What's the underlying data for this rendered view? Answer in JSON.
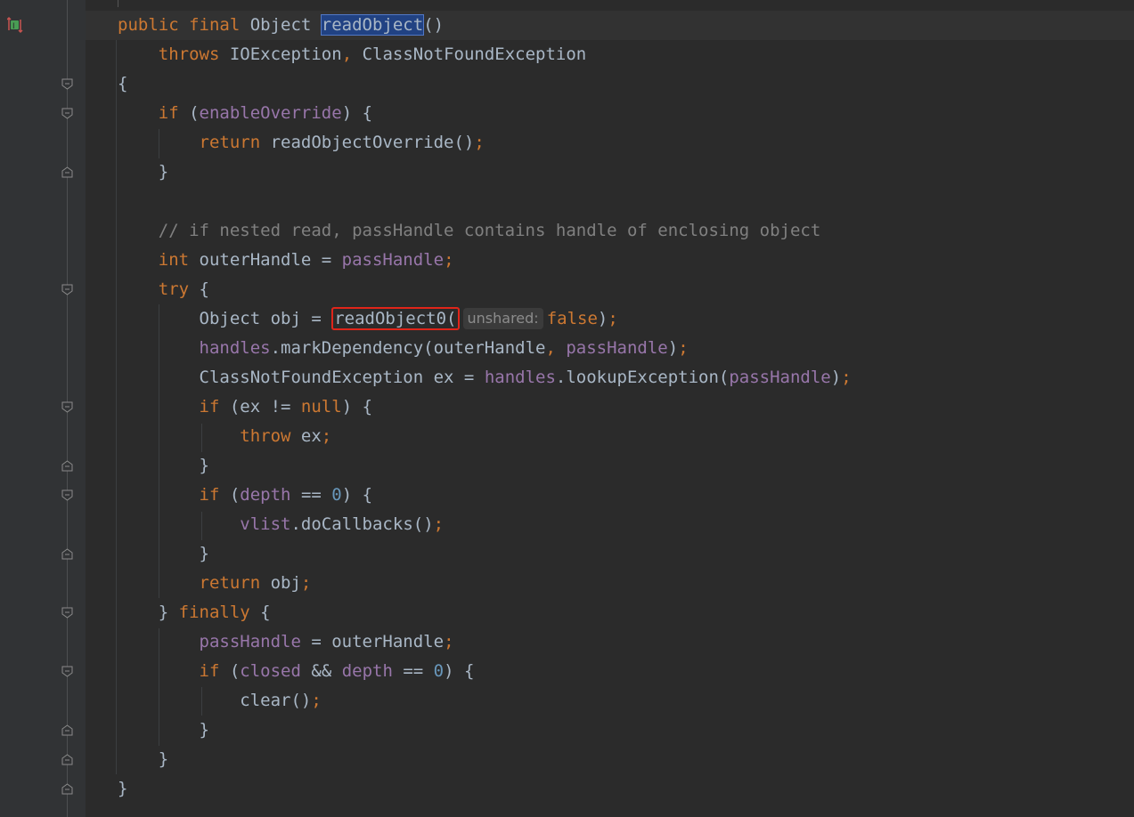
{
  "editor": {
    "lines": [
      {
        "tokens": [
          {
            "t": "public final ",
            "c": "kw"
          },
          {
            "t": "Object ",
            "c": "plain"
          },
          {
            "t": "readObject",
            "c": "sel"
          },
          {
            "t": "()",
            "c": "plain"
          }
        ]
      },
      {
        "tokens": [
          {
            "t": "    throws ",
            "c": "kw"
          },
          {
            "t": "IOException",
            "c": "plain"
          },
          {
            "t": ", ",
            "c": "kw"
          },
          {
            "t": "ClassNotFoundException",
            "c": "plain"
          }
        ]
      },
      {
        "tokens": [
          {
            "t": "{",
            "c": "plain"
          }
        ]
      },
      {
        "tokens": [
          {
            "t": "    if ",
            "c": "kw"
          },
          {
            "t": "(",
            "c": "plain"
          },
          {
            "t": "enableOverride",
            "c": "fld"
          },
          {
            "t": ") {",
            "c": "plain"
          }
        ]
      },
      {
        "tokens": [
          {
            "t": "        return ",
            "c": "kw"
          },
          {
            "t": "readObjectOverride()",
            "c": "plain"
          },
          {
            "t": ";",
            "c": "kw"
          }
        ]
      },
      {
        "tokens": [
          {
            "t": "    }",
            "c": "plain"
          }
        ]
      },
      {
        "tokens": []
      },
      {
        "tokens": [
          {
            "t": "    // if nested read, passHandle contains handle of enclosing object",
            "c": "cmt"
          }
        ]
      },
      {
        "tokens": [
          {
            "t": "    int ",
            "c": "kw"
          },
          {
            "t": "outerHandle = ",
            "c": "plain"
          },
          {
            "t": "passHandle",
            "c": "fld"
          },
          {
            "t": ";",
            "c": "kw"
          }
        ]
      },
      {
        "tokens": [
          {
            "t": "    try ",
            "c": "kw"
          },
          {
            "t": "{",
            "c": "plain"
          }
        ]
      },
      {
        "tokens": [
          {
            "t": "        Object obj = ",
            "c": "plain"
          },
          {
            "t": "readObject0(",
            "c": "boxed"
          },
          {
            "t": "unshared:",
            "c": "hint"
          },
          {
            "t": "false",
            "c": "kw"
          },
          {
            "t": ")",
            "c": "plain"
          },
          {
            "t": ";",
            "c": "kw"
          }
        ]
      },
      {
        "tokens": [
          {
            "t": "        ",
            "c": "plain"
          },
          {
            "t": "handles",
            "c": "fld"
          },
          {
            "t": ".markDependency(outerHandle",
            "c": "plain"
          },
          {
            "t": ", ",
            "c": "kw"
          },
          {
            "t": "passHandle",
            "c": "fld"
          },
          {
            "t": ")",
            "c": "plain"
          },
          {
            "t": ";",
            "c": "kw"
          }
        ]
      },
      {
        "tokens": [
          {
            "t": "        ClassNotFoundException ex = ",
            "c": "plain"
          },
          {
            "t": "handles",
            "c": "fld"
          },
          {
            "t": ".lookupException(",
            "c": "plain"
          },
          {
            "t": "passHandle",
            "c": "fld"
          },
          {
            "t": ")",
            "c": "plain"
          },
          {
            "t": ";",
            "c": "kw"
          }
        ]
      },
      {
        "tokens": [
          {
            "t": "        if ",
            "c": "kw"
          },
          {
            "t": "(ex != ",
            "c": "plain"
          },
          {
            "t": "null",
            "c": "kw"
          },
          {
            "t": ") {",
            "c": "plain"
          }
        ]
      },
      {
        "tokens": [
          {
            "t": "            throw ",
            "c": "kw"
          },
          {
            "t": "ex",
            "c": "plain"
          },
          {
            "t": ";",
            "c": "kw"
          }
        ]
      },
      {
        "tokens": [
          {
            "t": "        }",
            "c": "plain"
          }
        ]
      },
      {
        "tokens": [
          {
            "t": "        if ",
            "c": "kw"
          },
          {
            "t": "(",
            "c": "plain"
          },
          {
            "t": "depth",
            "c": "fld"
          },
          {
            "t": " == ",
            "c": "plain"
          },
          {
            "t": "0",
            "c": "num"
          },
          {
            "t": ") {",
            "c": "plain"
          }
        ]
      },
      {
        "tokens": [
          {
            "t": "            ",
            "c": "plain"
          },
          {
            "t": "vlist",
            "c": "fld"
          },
          {
            "t": ".doCallbacks()",
            "c": "plain"
          },
          {
            "t": ";",
            "c": "kw"
          }
        ]
      },
      {
        "tokens": [
          {
            "t": "        }",
            "c": "plain"
          }
        ]
      },
      {
        "tokens": [
          {
            "t": "        return ",
            "c": "kw"
          },
          {
            "t": "obj",
            "c": "plain"
          },
          {
            "t": ";",
            "c": "kw"
          }
        ]
      },
      {
        "tokens": [
          {
            "t": "    } ",
            "c": "plain"
          },
          {
            "t": "finally ",
            "c": "kw"
          },
          {
            "t": "{",
            "c": "plain"
          }
        ]
      },
      {
        "tokens": [
          {
            "t": "        ",
            "c": "plain"
          },
          {
            "t": "passHandle",
            "c": "fld"
          },
          {
            "t": " = outerHandle",
            "c": "plain"
          },
          {
            "t": ";",
            "c": "kw"
          }
        ]
      },
      {
        "tokens": [
          {
            "t": "        if ",
            "c": "kw"
          },
          {
            "t": "(",
            "c": "plain"
          },
          {
            "t": "closed",
            "c": "fld"
          },
          {
            "t": " && ",
            "c": "plain"
          },
          {
            "t": "depth",
            "c": "fld"
          },
          {
            "t": " == ",
            "c": "plain"
          },
          {
            "t": "0",
            "c": "num"
          },
          {
            "t": ") {",
            "c": "plain"
          }
        ]
      },
      {
        "tokens": [
          {
            "t": "            clear()",
            "c": "plain"
          },
          {
            "t": ";",
            "c": "kw"
          }
        ]
      },
      {
        "tokens": [
          {
            "t": "        }",
            "c": "plain"
          }
        ]
      },
      {
        "tokens": [
          {
            "t": "    }",
            "c": "plain"
          }
        ]
      },
      {
        "tokens": [
          {
            "t": "}",
            "c": "plain"
          }
        ]
      }
    ]
  },
  "gutter": {
    "method_icon": "implementing-method-icon",
    "fold_markers": [
      {
        "line": 2,
        "kind": "open"
      },
      {
        "line": 3,
        "kind": "open"
      },
      {
        "line": 5,
        "kind": "close"
      },
      {
        "line": 9,
        "kind": "open"
      },
      {
        "line": 13,
        "kind": "open"
      },
      {
        "line": 15,
        "kind": "close"
      },
      {
        "line": 16,
        "kind": "open"
      },
      {
        "line": 18,
        "kind": "close"
      },
      {
        "line": 20,
        "kind": "open"
      },
      {
        "line": 22,
        "kind": "open"
      },
      {
        "line": 24,
        "kind": "close"
      },
      {
        "line": 25,
        "kind": "close"
      },
      {
        "line": 26,
        "kind": "close"
      }
    ]
  },
  "colors": {
    "background": "#2b2b2b",
    "keyword": "#cc7832",
    "field": "#9876aa",
    "number": "#6897bb",
    "comment": "#808080",
    "text": "#a9b7c6",
    "highlight_box": "#e0251a",
    "selection": "#214283"
  }
}
